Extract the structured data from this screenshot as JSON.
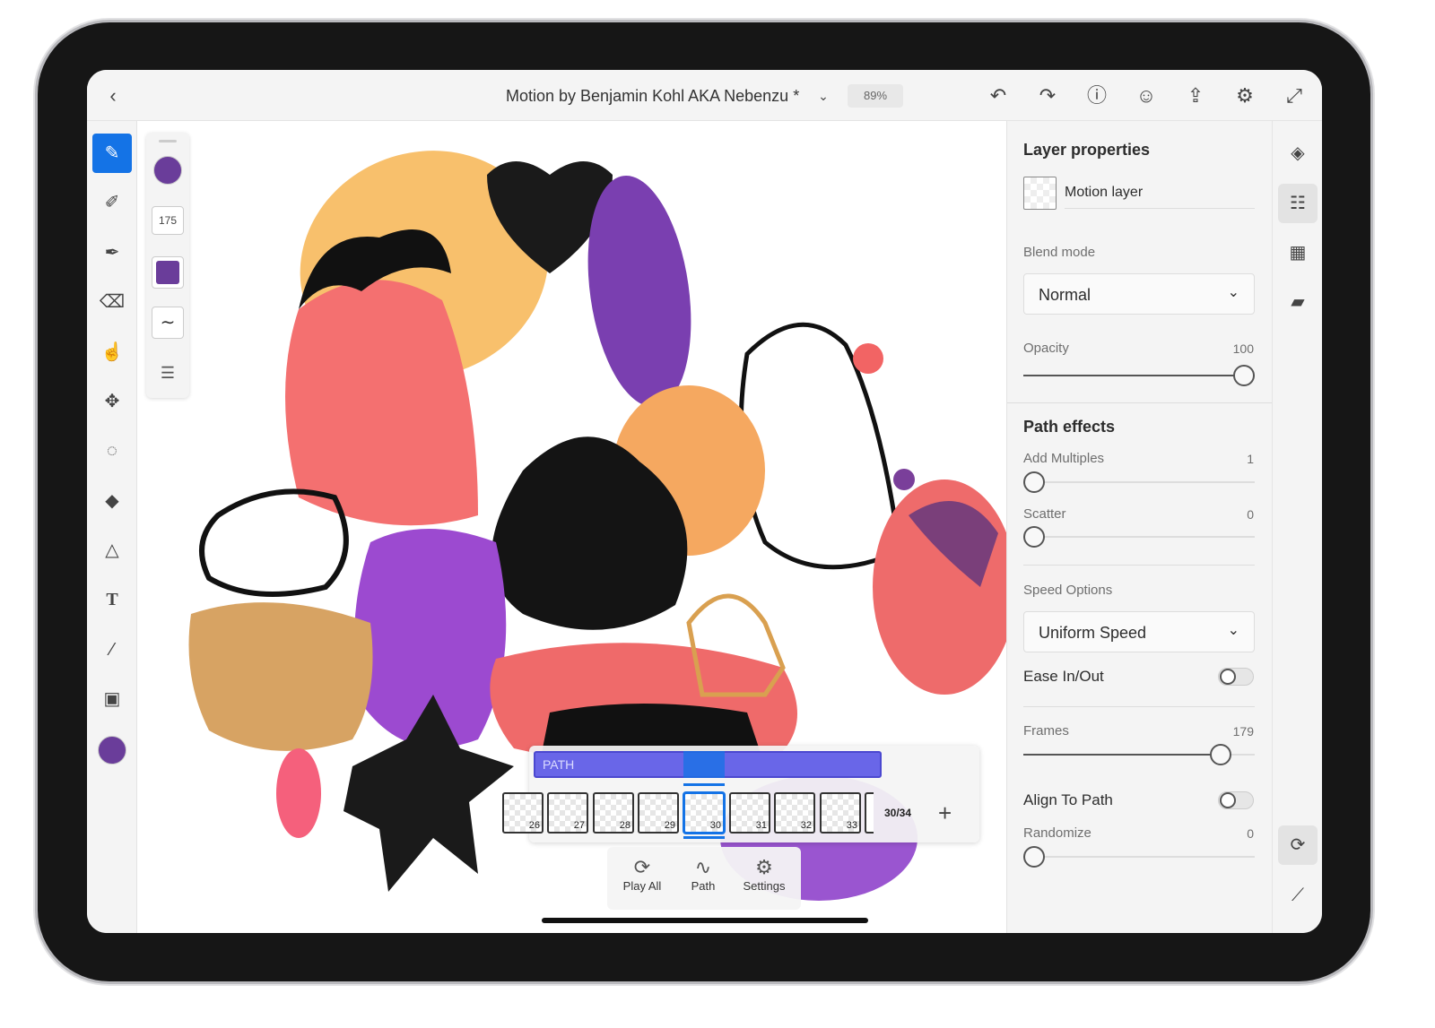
{
  "header": {
    "title": "Motion by Benjamin Kohl AKA Nebenzu *",
    "zoom": "89%",
    "icons": [
      "back-chevron",
      "title-chevron-down",
      "undo",
      "redo",
      "help",
      "invite-user",
      "share",
      "settings-gear",
      "fullscreen"
    ]
  },
  "left_toolbar": {
    "tools": [
      "pixel-brush",
      "live-brush",
      "vector-brush",
      "eraser",
      "smudge",
      "move-transform",
      "lasso-select",
      "fill",
      "shapes",
      "type",
      "eyedropper",
      "place-image"
    ],
    "active": "pixel-brush",
    "current_color": "#6a3d9a"
  },
  "sub_toolbar": {
    "brush_size": "175",
    "color": "#6a3d9a",
    "icons": [
      "brush-preview",
      "size",
      "color-square",
      "stroke-smoothing",
      "brush-settings"
    ]
  },
  "panel": {
    "layer_properties": {
      "heading": "Layer properties",
      "layer_name": "Motion layer",
      "blend_label": "Blend mode",
      "blend_value": "Normal",
      "opacity_label": "Opacity",
      "opacity_value": "100"
    },
    "path_effects": {
      "heading": "Path effects",
      "add_multiples_label": "Add Multiples",
      "add_multiples_value": "1",
      "scatter_label": "Scatter",
      "scatter_value": "0",
      "speed_label": "Speed Options",
      "speed_value": "Uniform Speed",
      "ease_label": "Ease In/Out",
      "ease_on": false,
      "frames_label": "Frames",
      "frames_value": "179",
      "align_label": "Align To Path",
      "align_on": false,
      "randomize_label": "Randomize",
      "randomize_value": "0"
    }
  },
  "rail": {
    "icons": [
      "layers",
      "layer-properties",
      "grid",
      "comments",
      "motion",
      "ruler"
    ],
    "active": "layer-properties"
  },
  "timeline": {
    "track_label": "PATH",
    "frames": [
      "26",
      "27",
      "28",
      "29",
      "30",
      "31",
      "32",
      "33"
    ],
    "current_frame": "30",
    "counter": "30/34",
    "accent": "#1473e6",
    "track_color": "#6966e8"
  },
  "bottom_bar": {
    "play_all": "Play All",
    "path": "Path",
    "settings": "Settings"
  }
}
